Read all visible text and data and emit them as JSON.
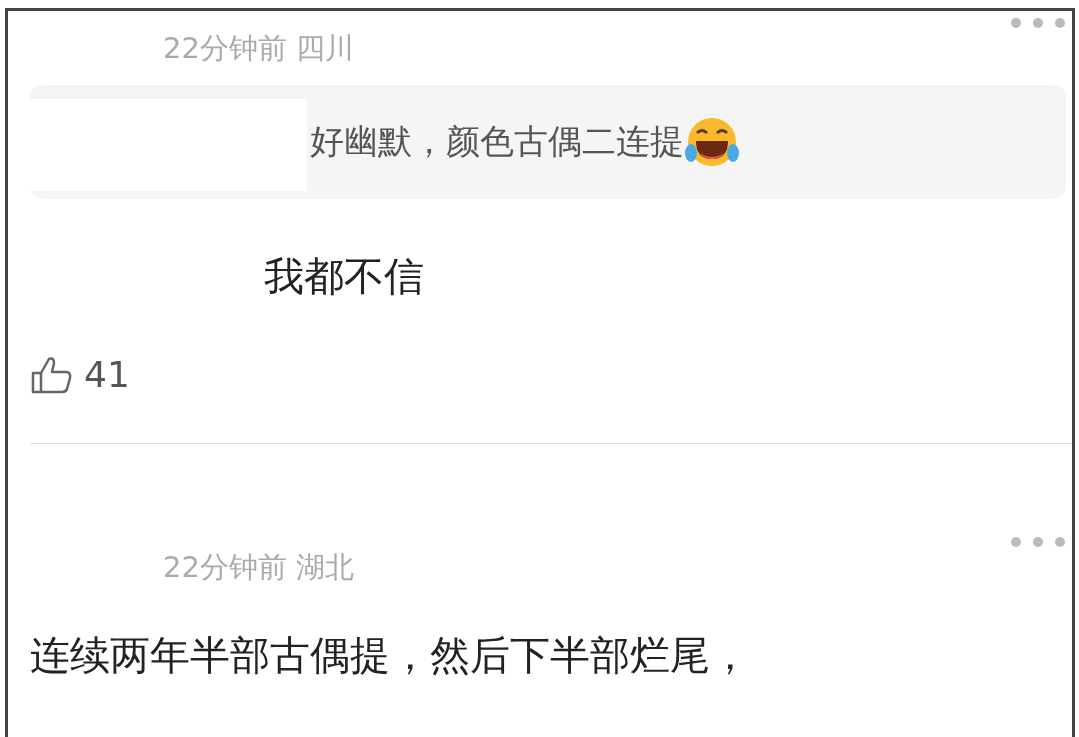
{
  "comments": [
    {
      "meta": "22分钟前 四川",
      "quote": {
        "text": "好幽默，颜色古偶二连提",
        "emoji": true
      },
      "body": "我都不信",
      "likes": "41"
    },
    {
      "meta": "22分钟前 湖北",
      "body": "连续两年半部古偶提，然后下半部烂尾，"
    }
  ]
}
